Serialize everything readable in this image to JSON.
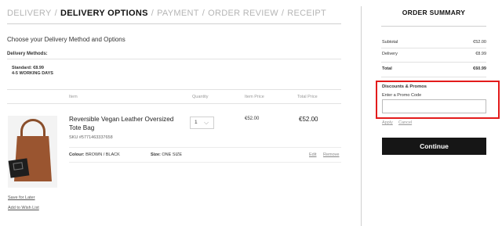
{
  "steps": {
    "delivery": "DELIVERY",
    "delivery_options": "DELIVERY OPTIONS",
    "payment": "PAYMENT",
    "order_review": "ORDER REVIEW",
    "receipt": "RECEIPT",
    "separator": "/"
  },
  "main": {
    "heading": "Choose your Delivery Method and Options",
    "delivery_methods_label": "Delivery Methods:",
    "standard_line1": "Standard: €8.99",
    "standard_line2": "4-5 WORKING DAYS"
  },
  "table": {
    "headers": {
      "item": "Item",
      "quantity": "Quantity",
      "item_price": "Item Price",
      "total_price": "Total Price"
    }
  },
  "product": {
    "name": "Reversible Vegan Leather Oversized Tote Bag",
    "sku": "SKU #5771463337658",
    "quantity": "1",
    "item_price": "€52.00",
    "total_price": "€52.00",
    "colour_label": "Colour:",
    "colour_value": "BROWN / BLACK",
    "size_label": "Size:",
    "size_value": "ONE SIZE",
    "edit": "Edit",
    "remove": "Remove",
    "save_for_later": "Save for Later",
    "add_to_wish_list": "Add to Wish List"
  },
  "summary": {
    "title": "ORDER SUMMARY",
    "subtotal_label": "Subtotal",
    "subtotal_value": "€52.00",
    "delivery_label": "Delivery",
    "delivery_value": "€8.99",
    "total_label": "Total",
    "total_value": "€60.99"
  },
  "promo": {
    "title": "Discounts & Promos",
    "label": "Enter a Promo Code",
    "value": "",
    "apply": "Apply",
    "cancel": "Cancel",
    "highlight_color": "#e31b1b"
  },
  "continue_label": "Continue",
  "icons": {
    "quantity_dropdown": "chevron-down-icon"
  }
}
